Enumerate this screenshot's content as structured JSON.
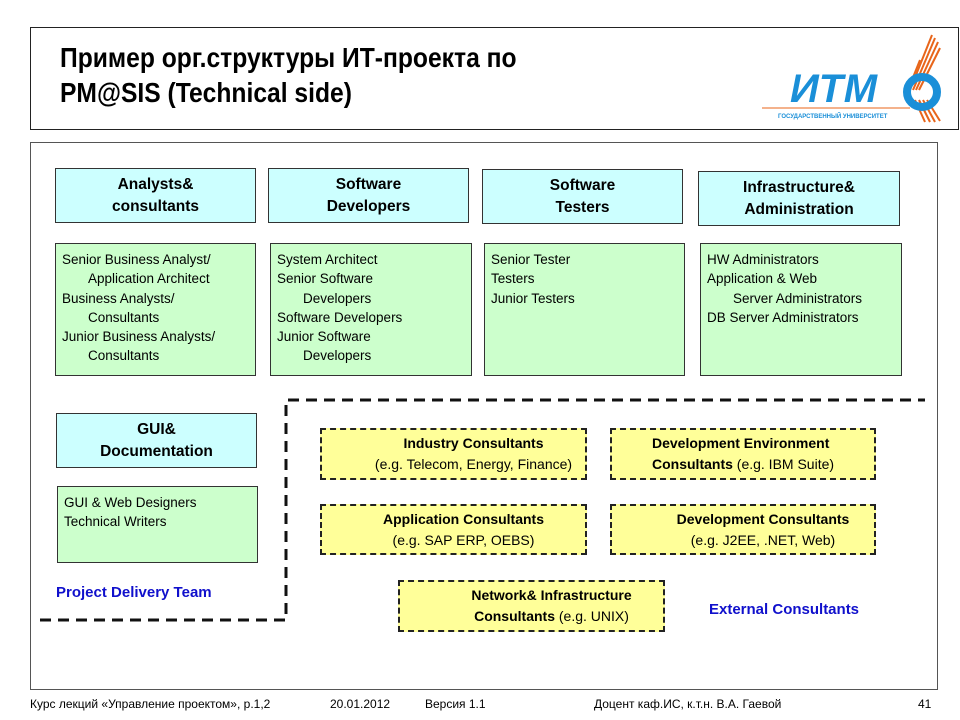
{
  "header": {
    "title_lines": [
      "Пример орг.структуры ИТ-проекта по",
      "PM@SIS (Technical side)"
    ],
    "logo": {
      "name": "ИТМО",
      "subtitle": "ГОСУДАРСТВЕННЫЙ УНИВЕРСИТЕТ",
      "colors": {
        "primary": "#1a8fd8",
        "accent": "#e8651a"
      }
    }
  },
  "project_delivery_team": {
    "label": "Project Delivery Team",
    "groups": [
      {
        "title": [
          "Analysts&",
          "consultants"
        ],
        "roles": [
          {
            "text": "Senior Business Analyst/",
            "indent": false
          },
          {
            "text": "Application Architect",
            "indent": true
          },
          {
            "text": "Business Analysts/",
            "indent": false
          },
          {
            "text": "Consultants",
            "indent": true
          },
          {
            "text": "Junior Business Analysts/",
            "indent": false
          },
          {
            "text": "Consultants",
            "indent": true
          }
        ]
      },
      {
        "title": [
          "Software",
          "Developers"
        ],
        "roles": [
          {
            "text": "System Architect",
            "indent": false
          },
          {
            "text": "Senior Software",
            "indent": false
          },
          {
            "text": "Developers",
            "indent": true
          },
          {
            "text": "Software Developers",
            "indent": false
          },
          {
            "text": "Junior Software",
            "indent": false
          },
          {
            "text": "Developers",
            "indent": true
          }
        ]
      },
      {
        "title": [
          "Software",
          "Testers"
        ],
        "roles": [
          {
            "text": "Senior Tester",
            "indent": false
          },
          {
            "text": "Testers",
            "indent": false
          },
          {
            "text": "Junior Testers",
            "indent": false
          }
        ]
      },
      {
        "title": [
          "Infrastructure&",
          "Administration"
        ],
        "roles": [
          {
            "text": "HW Administrators",
            "indent": false
          },
          {
            "text": "Application & Web",
            "indent": false
          },
          {
            "text": "Server Administrators",
            "indent": true
          },
          {
            "text": "DB Server Administrators",
            "indent": false
          }
        ]
      },
      {
        "title": [
          "GUI&",
          "Documentation"
        ],
        "roles": [
          {
            "text": "GUI & Web Designers",
            "indent": false
          },
          {
            "text": "Technical Writers",
            "indent": false
          }
        ]
      }
    ]
  },
  "external_consultants": {
    "label": "External Consultants",
    "items": [
      {
        "line1_bold": "Industry Consultants",
        "line1_rest": "",
        "line2_bold": "",
        "line2_rest": "(e.g. Telecom, Energy, Finance)"
      },
      {
        "line1_bold": "Development Environment",
        "line1_rest": "",
        "line2_bold": "Consultants",
        "line2_rest": " (e.g. IBM Suite)"
      },
      {
        "line1_bold": "Application Consultants",
        "line1_rest": "",
        "line2_bold": "",
        "line2_rest": "(e.g. SAP ERP, OEBS)"
      },
      {
        "line1_bold": "Development Consultants",
        "line1_rest": "",
        "line2_bold": "",
        "line2_rest": "(e.g. J2EE, .NET, Web)"
      },
      {
        "line1_bold": "Network& Infrastructure",
        "line1_rest": "",
        "line2_bold": "Consultants",
        "line2_rest": " (e.g. UNIX)"
      }
    ]
  },
  "footer": {
    "course": "Курс лекций «Управление проектом», р.1,2",
    "date": "20.01.2012",
    "version": "Версия 1.1",
    "author": "Доцент каф.ИС, к.т.н. В.А. Гаевой",
    "page": "41"
  },
  "colors": {
    "category_fill": "#ccffff",
    "roles_fill": "#ccffcc",
    "external_fill": "#ffff99",
    "team_label": "#1010cc"
  }
}
